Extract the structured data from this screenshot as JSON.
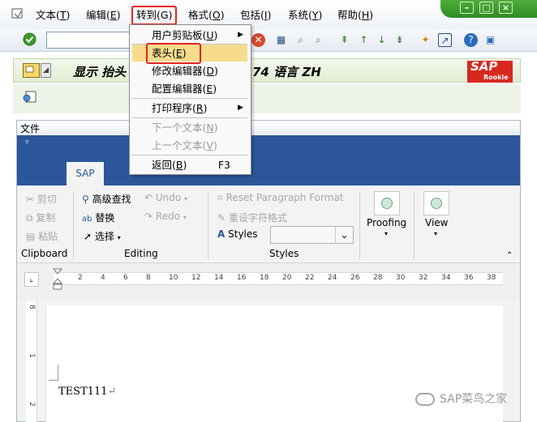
{
  "menubar": {
    "items": [
      {
        "label": "文本(",
        "key": "T",
        "tail": ")"
      },
      {
        "label": "编辑(",
        "key": "E",
        "tail": ")"
      },
      {
        "label": "转到(G)"
      },
      {
        "label": "格式(",
        "key": "O",
        "tail": ")"
      },
      {
        "label": "包括(",
        "key": "I",
        "tail": ")"
      },
      {
        "label": "系统(",
        "key": "Y",
        "tail": ")"
      },
      {
        "label": "帮助(",
        "key": "H",
        "tail": ")"
      }
    ]
  },
  "title": {
    "text": "显示 抬头",
    "text_tail": "74 语言 ZH",
    "logo_main": "SAP",
    "logo_sub": "Rookie"
  },
  "editor": {
    "file_label": "文件",
    "ribbon_tab": "SAP",
    "clipboard": {
      "cut": "剪切",
      "copy": "复制",
      "paste": "粘贴",
      "group": "Clipboard"
    },
    "editing": {
      "find": "高级查找",
      "replace": "替换",
      "select": "选择",
      "undo": "Undo",
      "redo": "Redo",
      "group": "Editing"
    },
    "styles": {
      "reset": "Reset Paragraph Format",
      "reset_char": "重设字符格式",
      "styles": "Styles",
      "group": "Styles"
    },
    "proofing": "Proofing",
    "view": "View",
    "ruler_ticks": [
      "2",
      "4",
      "6",
      "8",
      "10",
      "12",
      "14",
      "16",
      "18",
      "20",
      "22",
      "24",
      "26",
      "28",
      "30",
      "32",
      "34",
      "36",
      "38"
    ],
    "vruler_ticks": [
      "8",
      "1",
      "2"
    ],
    "doc_text": "TEST111",
    "pilcrow": "↵"
  },
  "dropdown": {
    "items": [
      {
        "label": "用户剪贴板(",
        "key": "U",
        "tail": ")",
        "submenu": "▶"
      },
      {
        "label": "表头(",
        "key": "E",
        "tail": ")",
        "highlighted": true
      },
      {
        "label": "修改编辑器(",
        "key": "D",
        "tail": ")"
      },
      {
        "label": "配置编辑器(",
        "key": "E",
        "tail": ")"
      },
      {
        "label": "打印程序(",
        "key": "R",
        "tail": ")",
        "submenu": "▶"
      },
      {
        "label": "下一个文本(",
        "key": "N",
        "tail": ")",
        "disabled": true
      },
      {
        "label": "上一个文本(",
        "key": "V",
        "tail": ")",
        "disabled": true
      },
      {
        "label": "返回(",
        "key": "B",
        "tail": ")",
        "accel": "F3"
      }
    ]
  },
  "watermark": "SAP菜鸟之家",
  "colors": {
    "accent_red": "#e52420",
    "highlight": "#f7dc8e",
    "blue_band": "#2b579a",
    "title_green": "#e0ecd2"
  }
}
